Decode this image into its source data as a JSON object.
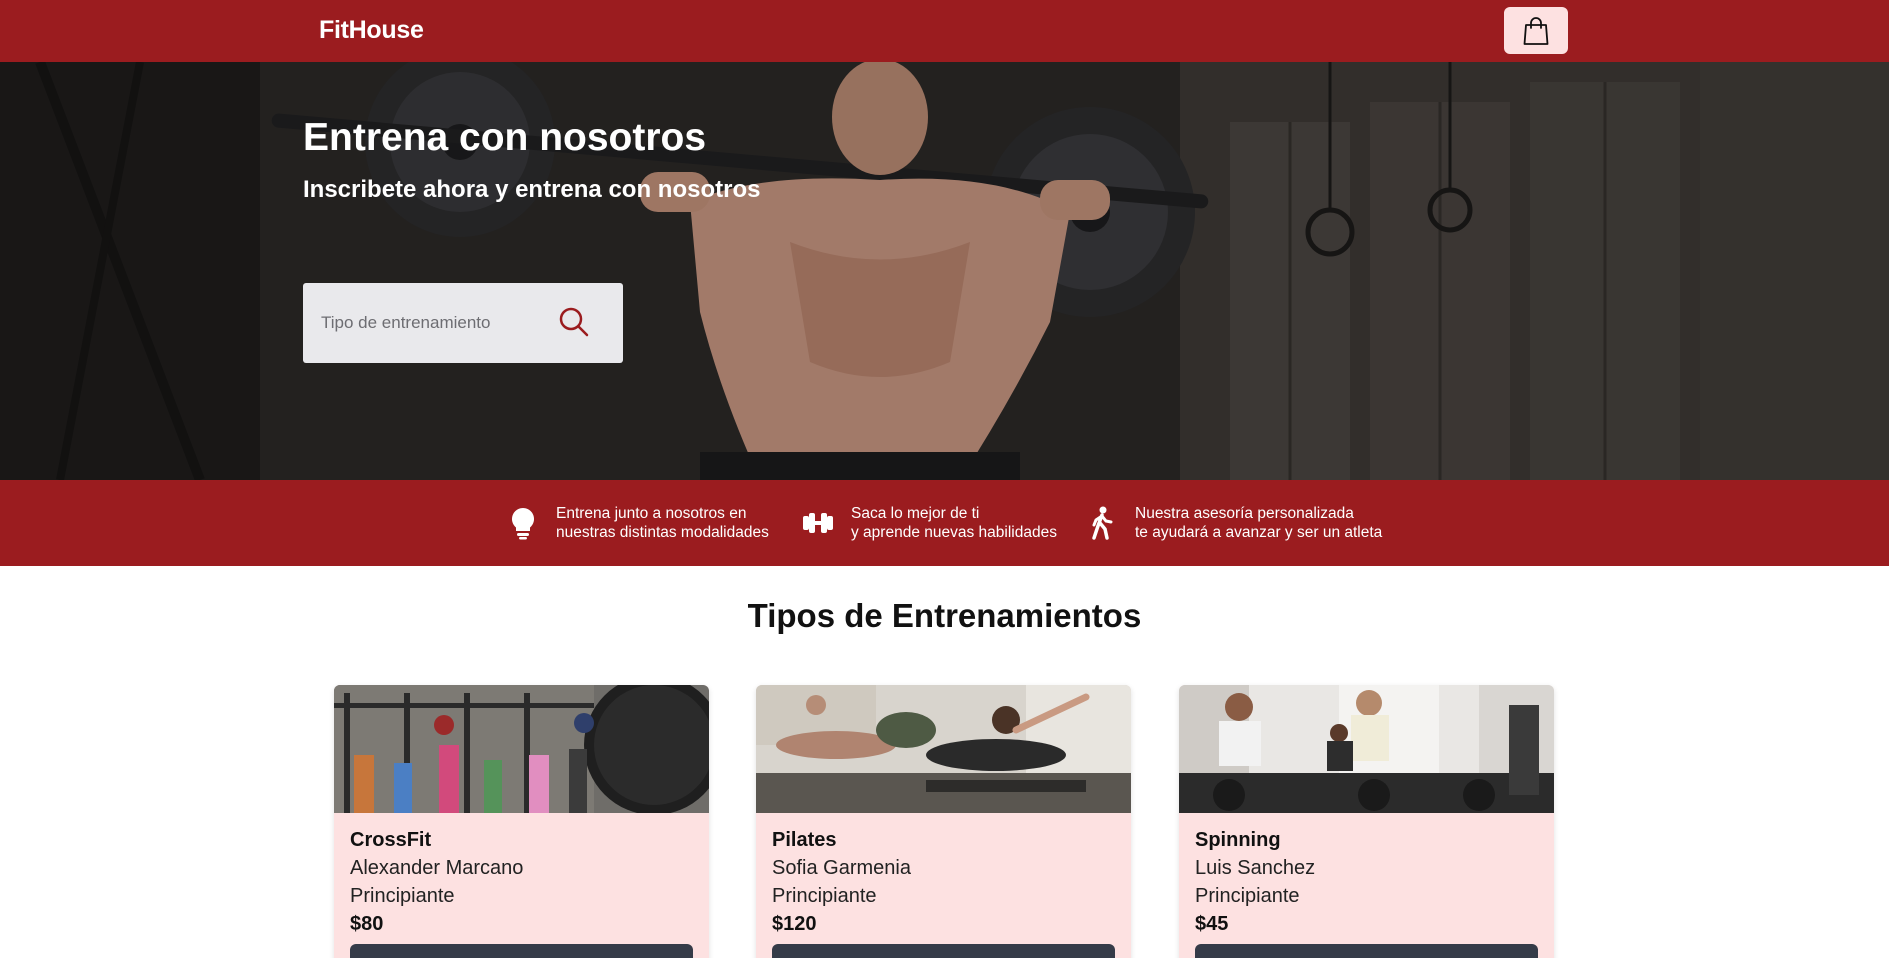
{
  "navbar": {
    "brand": "FitHouse",
    "cart_icon": "shopping-bag-icon",
    "background": "#9b1c1f"
  },
  "hero": {
    "title": "Entrena con nosotros",
    "subtitle": "Inscribete ahora y entrena con nosotros",
    "search": {
      "placeholder": "Tipo de entrenamiento",
      "value": "",
      "icon": "search-icon"
    }
  },
  "features": [
    {
      "icon": "lightbulb-icon",
      "line1": "Entrena junto a nosotros en",
      "line2": "nuestras distintas modalidades"
    },
    {
      "icon": "dumbbell-icon",
      "line1": "Saca lo mejor de ti",
      "line2": "y aprende nuevas habilidades"
    },
    {
      "icon": "walking-person-icon",
      "line1": "Nuestra asesoría personalizada",
      "line2": "te ayudará a avanzar y ser un atleta"
    }
  ],
  "section": {
    "title": "Tipos de Entrenamientos"
  },
  "cards": [
    {
      "name": "CrossFit",
      "coach": "Alexander Marcano",
      "level": "Principiante",
      "price": "$80"
    },
    {
      "name": "Pilates",
      "coach": "Sofia Garmenia",
      "level": "Principiante",
      "price": "$120"
    },
    {
      "name": "Spinning",
      "coach": "Luis Sanchez",
      "level": "Principiante",
      "price": "$45"
    }
  ],
  "colors": {
    "brand_red": "#9b1c1f",
    "card_bg": "#fde1e1",
    "button_dark": "#353b48"
  }
}
